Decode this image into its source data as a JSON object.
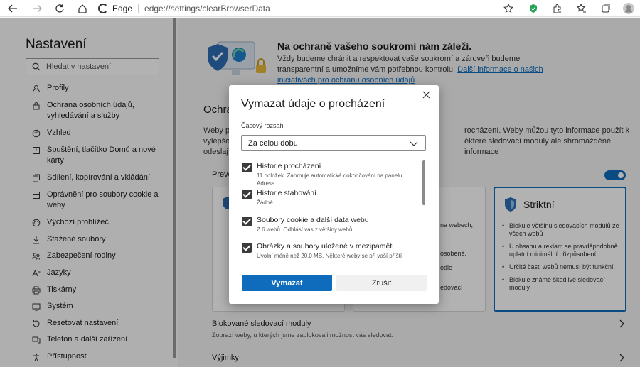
{
  "browser": {
    "site_label": "Edge",
    "url": "edge://settings/clearBrowserData"
  },
  "sidebar": {
    "title": "Nastavení",
    "search_placeholder": "Hledat v nastavení",
    "items": [
      {
        "label": "Profily",
        "icon": "profile-icon"
      },
      {
        "label": "Ochrana osobních údajů, vyhledávání a služby",
        "icon": "lock-icon"
      },
      {
        "label": "Vzhled",
        "icon": "appearance-icon"
      },
      {
        "label": "Spuštění, tlačítko Domů a nové karty",
        "icon": "power-icon"
      },
      {
        "label": "Sdílení, kopírování a vkládání",
        "icon": "share-icon"
      },
      {
        "label": "Oprávnění pro soubory cookie a weby",
        "icon": "permissions-icon"
      },
      {
        "label": "Výchozí prohlížeč",
        "icon": "browser-icon"
      },
      {
        "label": "Stažené soubory",
        "icon": "download-icon"
      },
      {
        "label": "Zabezpečení rodiny",
        "icon": "family-icon"
      },
      {
        "label": "Jazyky",
        "icon": "language-icon"
      },
      {
        "label": "Tiskárny",
        "icon": "printer-icon"
      },
      {
        "label": "Systém",
        "icon": "system-icon"
      },
      {
        "label": "Resetovat nastavení",
        "icon": "reset-icon"
      },
      {
        "label": "Telefon a další zařízení",
        "icon": "phone-icon"
      },
      {
        "label": "Přístupnost",
        "icon": "accessibility-icon"
      }
    ]
  },
  "main": {
    "hero_title": "Na ochraně vašeho soukromí nám záleží.",
    "hero_text": "Vždy budeme chránit a respektovat vaše soukromí a zároveň budeme transparentní a umožníme vám potřebnou kontrolu.",
    "hero_link": "Další informace o našich iniciativách pro ochranu osobních údajů",
    "section_title_fragment": "Ochra",
    "section_text_left_1": "Weby p",
    "section_text_left_2": "vylepšo",
    "section_text_left_3": "odeslaj",
    "section_text_right_1": "rocházení. Weby můžou tyto informace použít k",
    "section_text_right_2": "ěkteré sledovací moduly ale shromážděné informace",
    "prevent_label_fragment": "Preve",
    "strict_card": {
      "title": "Striktní",
      "bullets": [
        "Blokuje většinu sledovacích modulů ze všech webů",
        "U obsahu a reklam se pravděpodobně uplatní minimální přizpůsobení.",
        "Určité části webů nemusí být funkční.",
        "Blokuje známé škodlivé sledovací moduly."
      ]
    },
    "balanced_fragments": [
      "na webech,",
      "osobené.",
      "odle",
      "edovací"
    ],
    "rows": [
      {
        "title": "Blokované sledovací moduly",
        "desc": "Zobrazí weby, u kterých jsme zablokovali možnost vás sledovat."
      },
      {
        "title": "Výjimky",
        "desc": ""
      }
    ]
  },
  "dialog": {
    "title": "Vymazat údaje o procházení",
    "time_range_label": "Časový rozsah",
    "time_range_value": "Za celou dobu",
    "items": [
      {
        "title": "Historie procházení",
        "desc": "11 položek. Zahrnuje automatické dokončování na panelu Adresa."
      },
      {
        "title": "Historie stahování",
        "desc": "Žádné"
      },
      {
        "title": "Soubory cookie a další data webu",
        "desc": "Z 6 webů. Odhlásí vás z většiny webů."
      },
      {
        "title": "Obrázky a soubory uložené v mezipaměti",
        "desc": "Uvolní méně než 20,0 MB. Některé weby se při vaší příští"
      }
    ],
    "confirm_label": "Vymazat",
    "cancel_label": "Zrušit"
  }
}
